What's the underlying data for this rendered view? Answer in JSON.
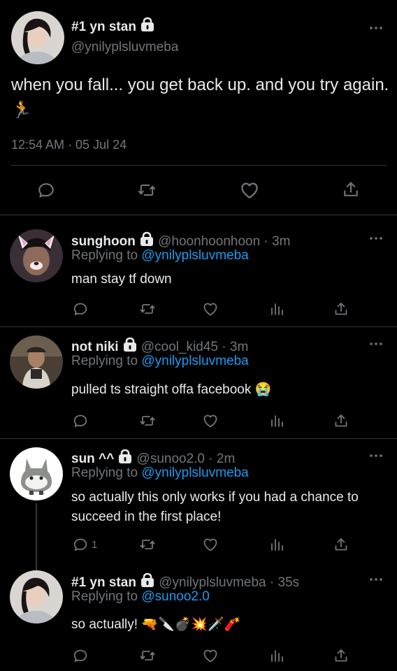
{
  "main_tweet": {
    "name": "#1 yn stan",
    "handle": "@ynilyplsluvmeba",
    "text": "when you fall... you get back up. and you try again. 🏃",
    "timestamp": "12:54 AM · 05 Jul 24",
    "icons": [
      "reply-icon",
      "retweet-icon",
      "like-icon",
      "share-icon"
    ]
  },
  "replies": [
    {
      "name": "sunghoon",
      "handle": "@hoonhoonhoon",
      "time": "3m",
      "replying_prefix": "Replying to",
      "replying_to": "@ynilyplsluvmeba",
      "text": "man stay tf down",
      "reply_count": ""
    },
    {
      "name": "not niki",
      "handle": "@cool_kid45",
      "time": "3m",
      "replying_prefix": "Replying to",
      "replying_to": "@ynilyplsluvmeba",
      "text": "pulled ts straight offa facebook 😭",
      "reply_count": ""
    },
    {
      "name": "sun ^^",
      "handle": "@sunoo2.0",
      "time": "2m",
      "replying_prefix": "Replying to",
      "replying_to": "@ynilyplsluvmeba",
      "text": "so actually this only works if you had a chance to succeed in the first place!",
      "reply_count": "1"
    },
    {
      "name": "#1 yn stan",
      "handle": "@ynilyplsluvmeba",
      "time": "35s",
      "replying_prefix": "Replying to",
      "replying_to": "@sunoo2.0",
      "text": "so actually! 🔫🔪💣💥🗡️🧨",
      "reply_count": ""
    }
  ],
  "colors": {
    "background": "#000000",
    "text": "#e7e9ea",
    "secondary": "#71767b",
    "link": "#1d9bf0",
    "divider": "#2f3336"
  }
}
